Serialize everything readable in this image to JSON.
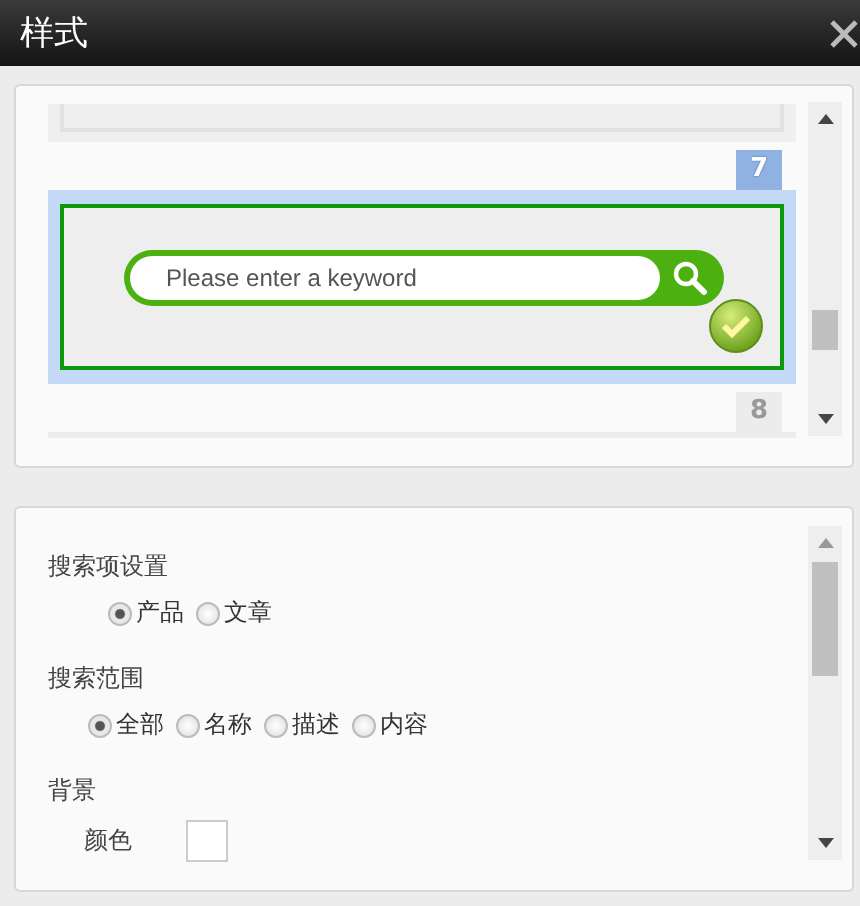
{
  "window": {
    "title": "样式"
  },
  "blocks": [
    {
      "number": "7",
      "selected": true,
      "search": {
        "placeholder": "Please enter a keyword"
      }
    },
    {
      "number": "8",
      "selected": false
    }
  ],
  "settings": [
    {
      "kind": "radio",
      "label": "搜索项设置",
      "options": [
        {
          "label": "产品",
          "selected": true
        },
        {
          "label": "文章",
          "selected": false
        }
      ]
    },
    {
      "kind": "radio",
      "label": "搜索范围",
      "options": [
        {
          "label": "全部",
          "selected": true
        },
        {
          "label": "名称",
          "selected": false
        },
        {
          "label": "描述",
          "selected": false
        },
        {
          "label": "内容",
          "selected": false
        }
      ]
    },
    {
      "kind": "color",
      "label": "背景",
      "field": "颜色",
      "color": "#ffffff"
    }
  ]
}
